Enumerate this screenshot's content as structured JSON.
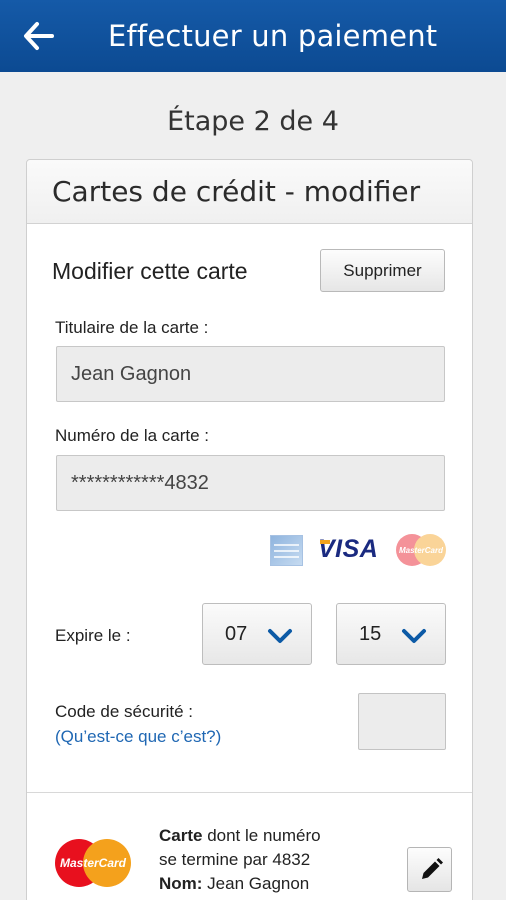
{
  "header": {
    "title": "Effectuer un paiement",
    "back_icon": "arrow-left-icon"
  },
  "step": "Étape 2 de 4",
  "card": {
    "title": "Cartes de crédit - modifier",
    "section_title": "Modifier cette carte",
    "delete_label": "Supprimer",
    "holder_label": "Titulaire de la carte :",
    "holder_value": "Jean Gagnon",
    "number_label": "Numéro de la carte :",
    "number_value": "************4832",
    "accepted_cards": [
      "American Express",
      "VISA",
      "MasterCard"
    ],
    "visa_text": "VISA",
    "mc_small_text": "MasterCard",
    "expiry_label": "Expire le :",
    "expiry_month": "07",
    "expiry_year": "15",
    "cvv_label": "Code de sécurité :",
    "cvv_help_link": "(Qu’est-ce que c’est?)"
  },
  "saved_card": {
    "brand_text": "MasterCard",
    "line1_bold": "Carte",
    "line1_rest": " dont le numéro",
    "line2": "se termine par 4832",
    "line3_bold": "Nom:",
    "line3_rest": " Jean Gagnon",
    "edit_icon": "pencil-icon"
  },
  "colors": {
    "header_bg": "#0c4a92",
    "link": "#1f67b3",
    "chevron": "#0c5aa6"
  }
}
